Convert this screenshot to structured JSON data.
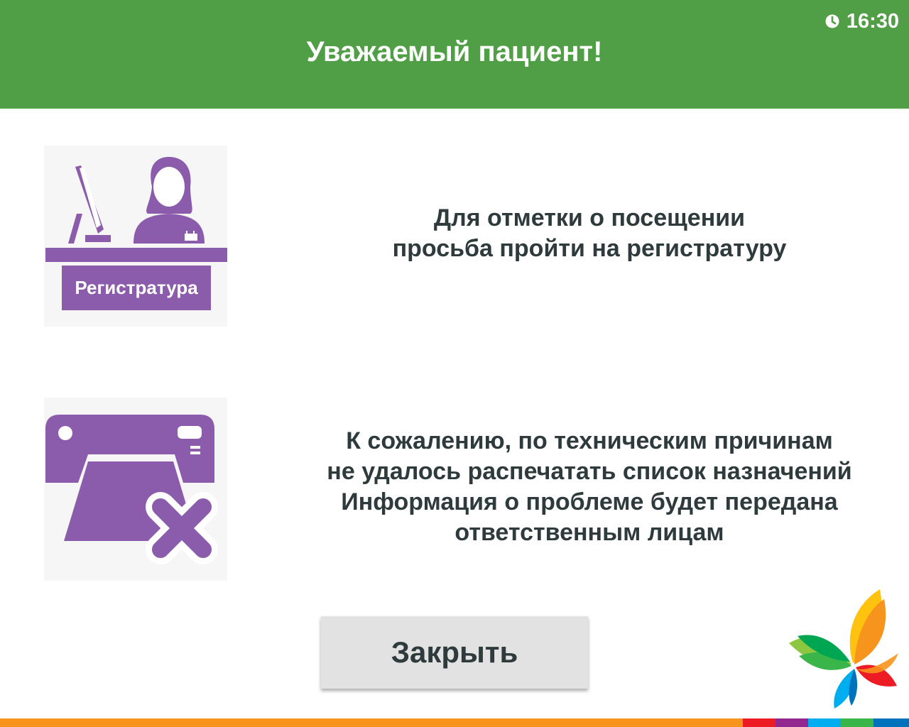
{
  "header": {
    "title": "Уважаемый пациент!",
    "time": "16:30",
    "time_icon": "clock-icon",
    "background": "#509e45"
  },
  "registry": {
    "icon": "registry-desk-icon",
    "label": "Регистратура",
    "message_lines": [
      "Для отметки о посещении",
      "просьба пройти на регистратуру"
    ]
  },
  "printer_error": {
    "icon": "printer-error-icon",
    "message_lines": [
      "К сожалению, по техническим причинам",
      "не удалось распечатать список назначений",
      "Информация о проблеме будет передана",
      "ответственным лицам"
    ]
  },
  "close_button": {
    "label": "Закрыть"
  },
  "logo": {
    "icon": "butterfly-logo-icon"
  },
  "colors": {
    "accent_purple": "#8c5cac",
    "text": "#2f3a3d",
    "button_bg": "#e2e2e2",
    "footer_orange": "#f7941d"
  }
}
